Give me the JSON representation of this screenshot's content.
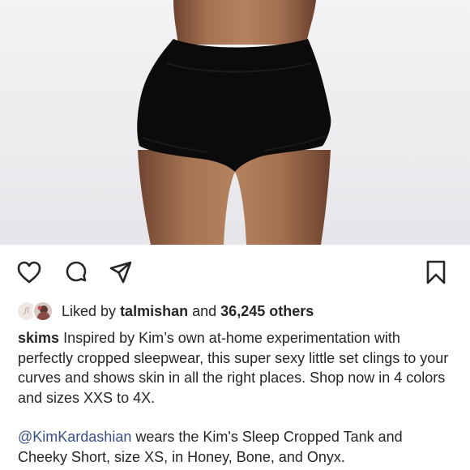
{
  "post": {
    "image_alt": "Model wearing black high-waisted cheeky shorts"
  },
  "actions": {
    "like_icon": "heart-outline-icon",
    "comment_icon": "comment-bubble-icon",
    "share_icon": "paper-plane-icon",
    "save_icon": "bookmark-outline-icon"
  },
  "likes": {
    "prefix": "Liked by",
    "user": "talmishan",
    "middle": "and",
    "count_text": "36,245 others"
  },
  "caption": {
    "username": "skims",
    "text": "Inspired by Kim’s own at-home experimentation with perfectly cropped sleepwear, this super sexy little set clings to your curves and shows skin in all the right places. Shop now in 4 colors and sizes XXS to 4X.",
    "mention": "@KimKardashian",
    "text2": "wears the Kim's Sleep Cropped Tank and Cheeky Short, size XS, in Honey, Bone, and Onyx."
  },
  "colors": {
    "text": "#262626",
    "mention": "#385185",
    "shorts": "#0b0b0b",
    "skin": "#9c6a4a"
  }
}
